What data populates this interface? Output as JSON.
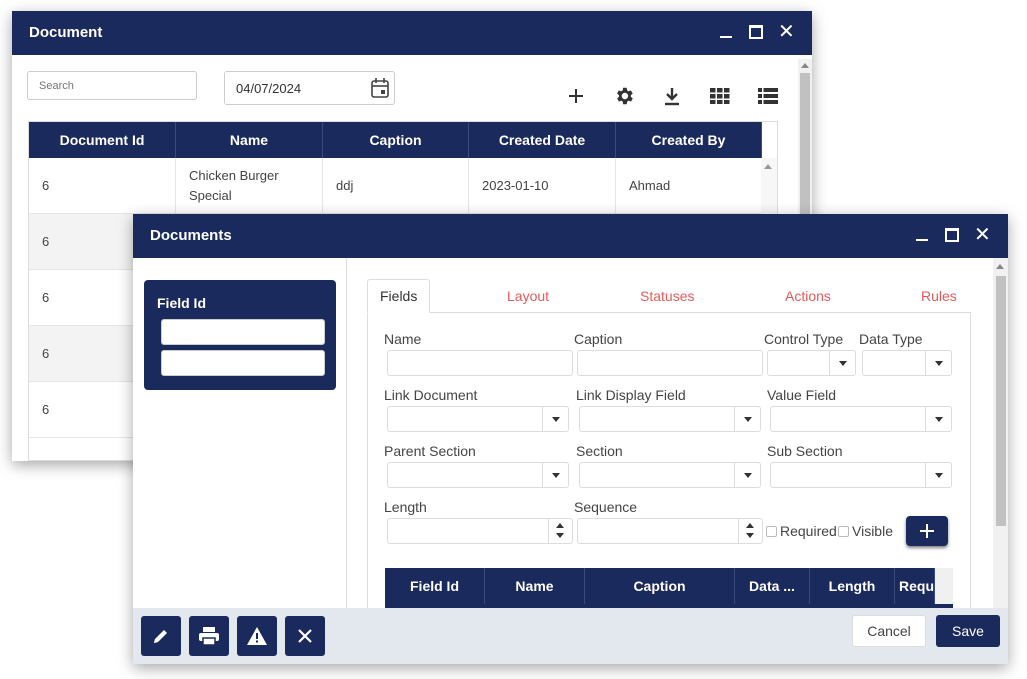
{
  "doc_window": {
    "title": "Document",
    "search_placeholder": "Search",
    "date_value": "04/07/2024",
    "columns": [
      "Document Id",
      "Name",
      "Caption",
      "Created Date",
      "Created By"
    ],
    "rows": [
      [
        "6",
        "Chicken Burger Special",
        "ddj",
        "2023-01-10",
        "Ahmad"
      ],
      [
        "6",
        "",
        "",
        "",
        ""
      ],
      [
        "6",
        "",
        "",
        "",
        ""
      ],
      [
        "6",
        "",
        "",
        "",
        ""
      ],
      [
        "6",
        "",
        "",
        "",
        ""
      ]
    ]
  },
  "docs_window": {
    "title": "Documents",
    "field_id_label": "Field Id",
    "tabs": [
      "Fields",
      "Layout",
      "Statuses",
      "Actions",
      "Rules"
    ],
    "labels": {
      "name": "Name",
      "caption": "Caption",
      "control_type": "Control Type",
      "data_type": "Data Type",
      "link_document": "Link Document",
      "link_display_field": "Link Display Field",
      "value_field": "Value Field",
      "parent_section": "Parent Section",
      "section": "Section",
      "sub_section": "Sub Section",
      "length": "Length",
      "sequence": "Sequence",
      "required": "Required",
      "visible": "Visible"
    },
    "grid_columns": [
      "Field Id",
      "Name",
      "Caption",
      "Data ...",
      "Length",
      "Requ"
    ],
    "cancel_label": "Cancel",
    "save_label": "Save"
  },
  "colors": {
    "navy": "#1b2a5c",
    "tab_red": "#e85a5a"
  }
}
